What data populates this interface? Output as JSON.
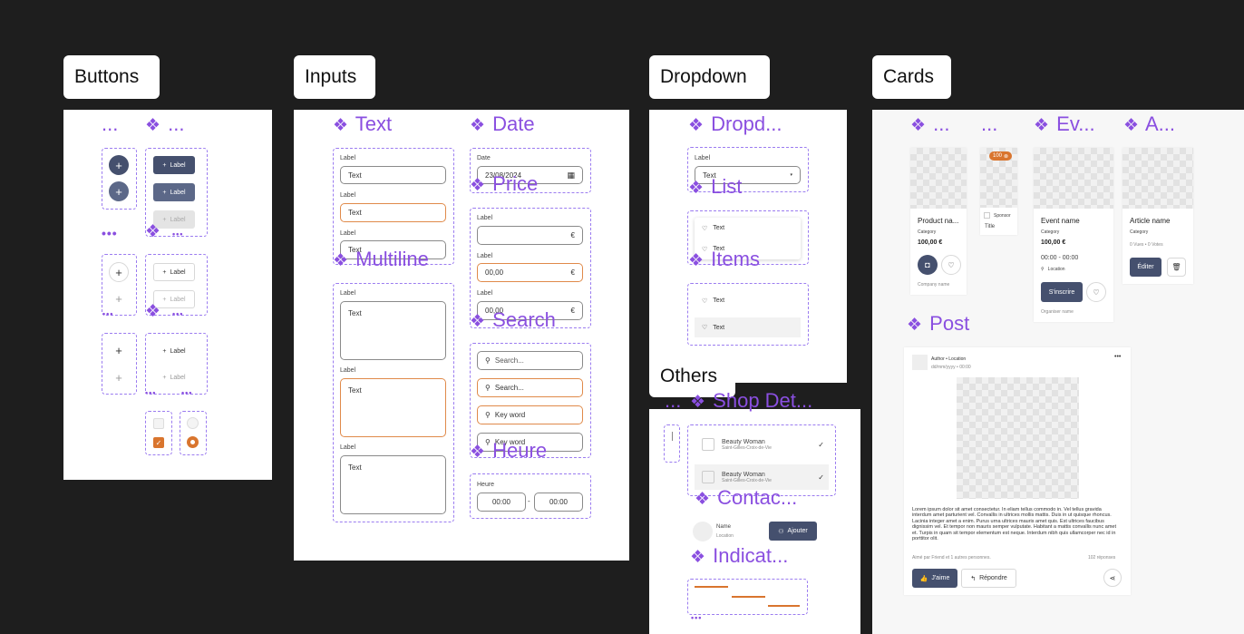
{
  "frames": {
    "buttons": "Buttons",
    "inputs": "Inputs",
    "dropdown": "Dropdown",
    "cards": "Cards",
    "others": "Others"
  },
  "titles": {
    "buttons_a": "...",
    "buttons_b": "...",
    "text": "Text",
    "date": "Date",
    "price": "Price",
    "multiline": "Multiline",
    "search": "Search",
    "heure": "Heure",
    "dropd": "Dropd...",
    "list": "List",
    "items": "Items",
    "shop": "Shop Det...",
    "contact": "Contac...",
    "indicat": "Indicat...",
    "card_a": "...",
    "card_b": "...",
    "card_ev": "Ev...",
    "card_art": "A...",
    "post": "Post"
  },
  "buttons": {
    "label": "Label",
    "plus": "+"
  },
  "inputs": {
    "field_label": "Label",
    "text_value": "Text",
    "date_label": "Date",
    "date_value": "23/08/2024",
    "price_value": "00,00",
    "currency": "€",
    "search_placeholder": "Search...",
    "keyword": "Key word",
    "heure_label": "Heure",
    "time_start": "00:00",
    "time_end": "00:00",
    "time_sep": "-"
  },
  "dropdown": {
    "label": "Label",
    "value": "Text",
    "list_item": "Text",
    "item": "Text"
  },
  "others": {
    "shop_name": "Beauty Woman",
    "shop_city": "Saint-Gilles-Croix-de-Vie",
    "contact_name": "Name",
    "contact_location": "Location",
    "add_button": "Ajouter"
  },
  "cards": {
    "product_name": "Product na...",
    "category": "Category",
    "price": "100,00 €",
    "company": "Company name",
    "badge": "100",
    "sponsor": "Sponsor",
    "sponsor_title": "Title",
    "event_name": "Event name",
    "event_time": "00:00 - 00:00",
    "event_location": "Location",
    "event_button": "S'inscrire",
    "organiser": "Organiser name",
    "article_name": "Article name",
    "article_stats": "0 Vues  •  0 Votes",
    "edit_button": "Éditer"
  },
  "post": {
    "author": "Author • Location",
    "date": "dd/mm/yyyy • 00:00",
    "menu": "•••",
    "body": "Lorem ipsum dolor sit amet consectetur. In eliam tellus commodo in. Vel tellus gravida interdum amet parturient vel. Convallis in ultrices mollis mattis. Duis in ut quisque rhoncus. Lacinia integer amet a enim. Purus urna ultrices mauris amet quis. Est ultrices faucibus dignissim vel. Et tempor non mauris semper vulputate. Habitant a mattis convallis nunc amet et. Turpis in quam sit tempor elementum est neque. Interdum nibh quis ullamcorper nec id in porttitor olit.",
    "likes_text": "Aimé par Friend et 1 autres personnes.",
    "replies": "102 réponses",
    "like_button": "J'aime",
    "reply_button": "Répondre"
  },
  "colors": {
    "background": "#1e1e1e",
    "accent_purple": "#8a4fe0",
    "primary_dark": "#45506e",
    "orange": "#d9752e"
  }
}
